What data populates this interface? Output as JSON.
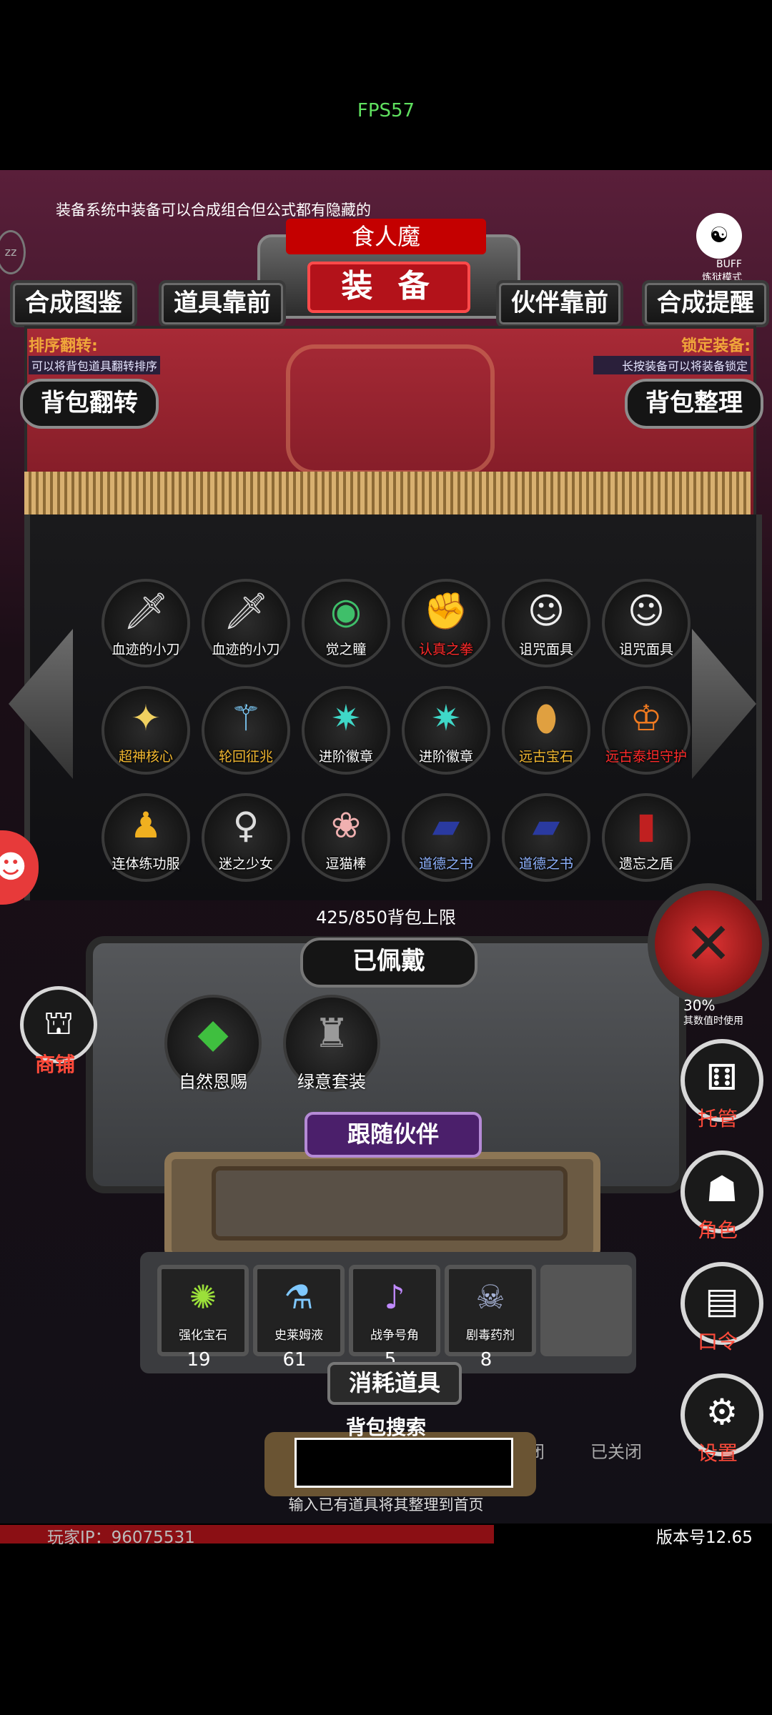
{
  "fps": "FPS57",
  "hint": "装备系统中装备可以合成组合但公式都有隐藏的",
  "header": {
    "title": "装 备",
    "subtitle": "食人魔",
    "buff_label": "BUFF",
    "mode": "炼狱模式"
  },
  "tabs": [
    "合成图鉴",
    "道具靠前",
    "伙伴靠前",
    "合成提醒"
  ],
  "left_info": {
    "title": "排序翻转:",
    "desc": "可以将背包道具翻转排序",
    "button": "背包翻转"
  },
  "right_info": {
    "title": "锁定装备:",
    "desc": "长按装备可以将装备锁定",
    "button": "背包整理"
  },
  "grid": [
    {
      "name": "血迹的小刀",
      "color": "#ffffff",
      "icon": "knife-icon"
    },
    {
      "name": "血迹的小刀",
      "color": "#ffffff",
      "icon": "knife-icon"
    },
    {
      "name": "觉之瞳",
      "color": "#ffffff",
      "icon": "eye-icon"
    },
    {
      "name": "认真之拳",
      "color": "#ff2a2a",
      "icon": "fist-icon"
    },
    {
      "name": "诅咒面具",
      "color": "#ffffff",
      "icon": "mask-icon"
    },
    {
      "name": "诅咒面具",
      "color": "#ffffff",
      "icon": "mask-icon"
    },
    {
      "name": "超神核心",
      "color": "#f2b830",
      "icon": "core-icon"
    },
    {
      "name": "轮回征兆",
      "color": "#f2b830",
      "icon": "wand-icon"
    },
    {
      "name": "进阶徽章",
      "color": "#ffffff",
      "icon": "badge-icon"
    },
    {
      "name": "进阶徽章",
      "color": "#ffffff",
      "icon": "badge-icon"
    },
    {
      "name": "远古宝石",
      "color": "#f2b830",
      "icon": "gem-icon"
    },
    {
      "name": "远古泰坦守护",
      "color": "#ff2a2a",
      "icon": "titan-icon"
    },
    {
      "name": "连体练功服",
      "color": "#ffffff",
      "icon": "suit-icon"
    },
    {
      "name": "迷之少女",
      "color": "#ffffff",
      "icon": "girl-icon"
    },
    {
      "name": "逗猫棒",
      "color": "#ffffff",
      "icon": "cat-toy-icon"
    },
    {
      "name": "道德之书",
      "color": "#8fb3ff",
      "icon": "book-icon"
    },
    {
      "name": "道德之书",
      "color": "#8fb3ff",
      "icon": "book-icon"
    },
    {
      "name": "遗忘之盾",
      "color": "#ffffff",
      "icon": "shield-icon"
    }
  ],
  "capacity": "425/850背包上限",
  "equipped": {
    "label": "已佩戴",
    "items": [
      {
        "name": "自然恩赐",
        "icon": "leaf-icon"
      },
      {
        "name": "绿意套装",
        "icon": "armor-icon"
      }
    ]
  },
  "percent": "30%",
  "percent_sub": "其数值时使用",
  "companion": {
    "label": "跟随伙伴"
  },
  "consumables": {
    "label": "消耗道具",
    "items": [
      {
        "name": "强化宝石",
        "count": "19",
        "icon": "green-gem-icon"
      },
      {
        "name": "史莱姆液",
        "count": "61",
        "icon": "potion-icon"
      },
      {
        "name": "战争号角",
        "count": "5",
        "icon": "horn-icon"
      },
      {
        "name": "剧毒药剂",
        "count": "8",
        "icon": "poison-icon"
      }
    ]
  },
  "search": {
    "label": "背包搜索",
    "placeholder": "",
    "hint": "输入已有道具将其整理到首页"
  },
  "closed_labels": [
    "闭",
    "已关闭"
  ],
  "side_menu": {
    "shop": "商铺",
    "dice": "托管",
    "role": "角色",
    "password": "口令",
    "settings": "设置"
  },
  "player_ip": "玩家IP：96075531",
  "version": "版本号12.65",
  "progress": 0.64
}
